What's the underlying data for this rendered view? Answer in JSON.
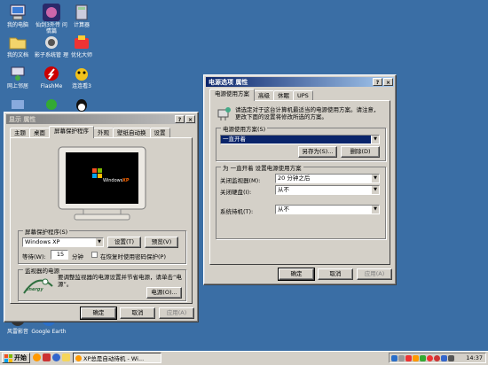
{
  "desktop": {
    "icons": [
      "我的电脑",
      "仙剑3外传 问情篇",
      "计算器",
      "我的文档",
      "影子系统管 理",
      "优化大师",
      "网上邻居",
      "FlashMe",
      "连连看3",
      "",
      "",
      "",
      "风雷影音",
      "Google Earth"
    ]
  },
  "display_props": {
    "title": "显示 属性",
    "tabs": [
      "主题",
      "桌面",
      "屏幕保护程序",
      "外观",
      "壁纸自动换",
      "设置"
    ],
    "selected_tab": "屏幕保护程序",
    "screensaver_group": "屏幕保护程序(S)",
    "screensaver_value": "Windows XP",
    "settings_button": "设置(T)",
    "preview_button": "预览(V)",
    "wait_label": "等待(W):",
    "wait_value": "15",
    "wait_unit": "分钟",
    "password_checkbox": "在恢复时使用密码保护(P)",
    "power_group": "监视器的电源",
    "power_text": "要调整监视器的电源设置并节省电源，请单击“电源”。",
    "power_button": "电源(O)...",
    "ok": "确定",
    "cancel": "取消",
    "apply": "应用(A)",
    "monitor_logo_text": "Windows",
    "monitor_logo_sub": "XP",
    "energy_logo": "energy"
  },
  "power_props": {
    "title": "电源选项 属性",
    "tabs": [
      "电源使用方案",
      "高级",
      "休眠",
      "UPS"
    ],
    "selected_tab": "电源使用方案",
    "description": "请选定对于这台计算机最适当的电源使用方案。请注意，更改下面的设置将修改所选的方案。",
    "scheme_label": "电源使用方案(S)",
    "scheme_value": "一直开着",
    "save_as": "另存为(S)...",
    "delete": "删除(D)",
    "settings_group": "为 一直开着 设置电源使用方案",
    "rows": [
      {
        "label": "关闭监视器(M):",
        "value": "20 分钟之后"
      },
      {
        "label": "关闭硬盘(I):",
        "value": "从不"
      },
      {
        "label": "系统待机(T):",
        "value": "从不"
      }
    ],
    "ok": "确定",
    "cancel": "取消",
    "apply": "应用(A)"
  },
  "taskbar": {
    "start": "开始",
    "task_item": "XP总是自动待机 - Wi...",
    "clock": "14:37"
  },
  "colors": {
    "desktop": "#3a6ea5",
    "active_title": "#0a246a",
    "inactive_title": "#808080",
    "face": "#d4d0c8"
  }
}
